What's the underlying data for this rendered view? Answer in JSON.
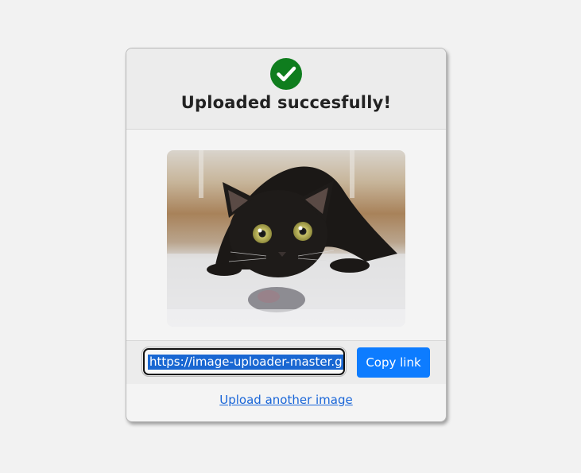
{
  "header": {
    "icon": "check-circle-icon",
    "title": "Uploaded succesfully!",
    "icon_color": "#0f7d1e"
  },
  "preview": {
    "icon": "cat-photo"
  },
  "link_bar": {
    "url_value": "https://image-uploader-master.glit",
    "copy_label": "Copy link",
    "button_color": "#0d7cff"
  },
  "footer": {
    "upload_another_label": "Upload another image"
  }
}
